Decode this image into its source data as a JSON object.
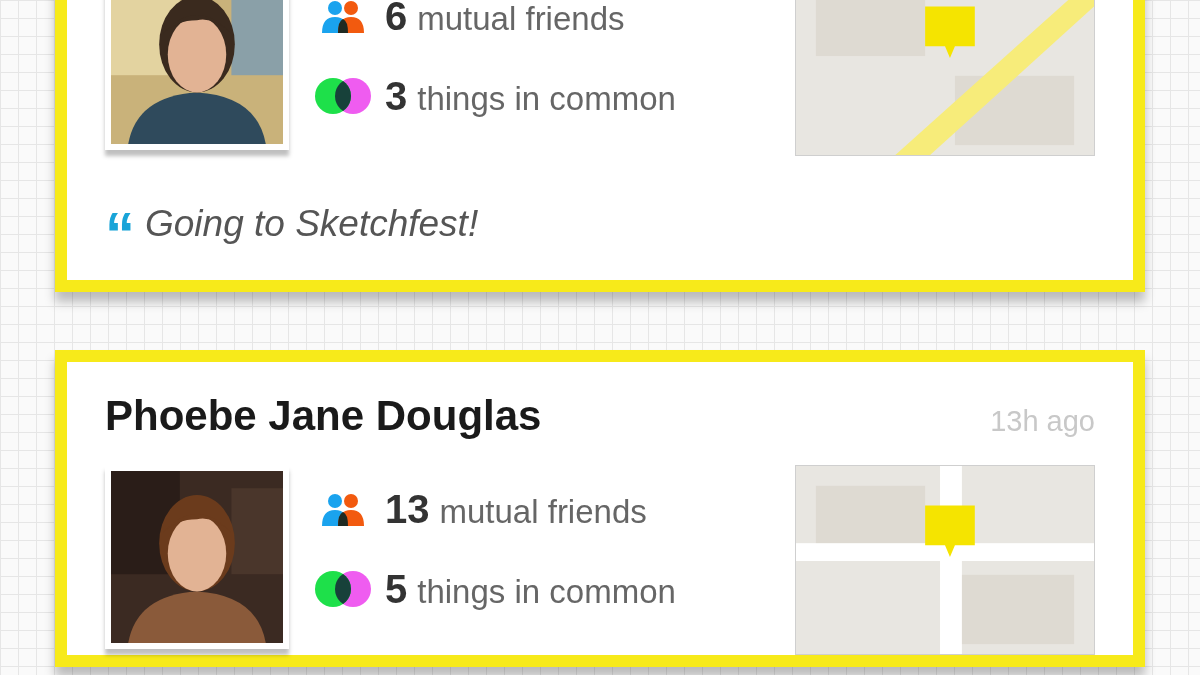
{
  "cards": [
    {
      "mutual_count": "6",
      "mutual_label": "mutual friends",
      "common_count": "3",
      "common_label": "things in common",
      "quote_mark": "“",
      "quote": "Going to Sketchfest!"
    },
    {
      "name": "Phoebe Jane Douglas",
      "time": "13h ago",
      "mutual_count": "13",
      "mutual_label": "mutual friends",
      "common_count": "5",
      "common_label": "things in common"
    }
  ]
}
